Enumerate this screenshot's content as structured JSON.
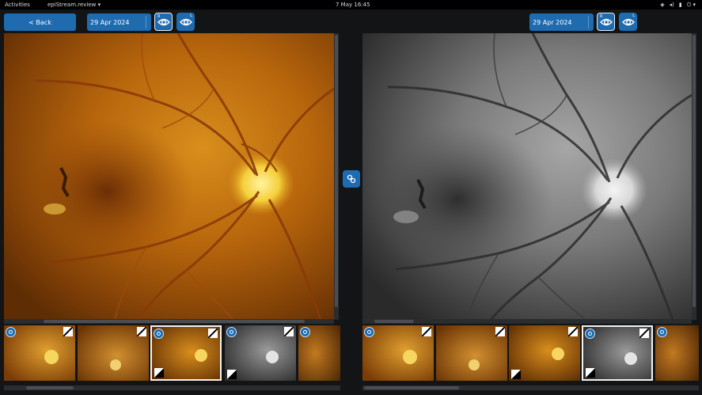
{
  "system_bar": {
    "activities": "Activities",
    "app_name": "epiStream.review ▾",
    "clock": "7 May  16:45",
    "tray_icons": [
      "network-icon",
      "volume-icon",
      "battery-icon",
      "power-icon"
    ],
    "tray_glyphs": [
      "◈",
      "◂)",
      "▮",
      "⏻ ▾"
    ]
  },
  "toolbar": {
    "back_label": "< Back"
  },
  "left_viewer": {
    "date": "29 Apr 2024",
    "eye_right_label": "R",
    "eye_left_label": "L",
    "image_kind": "color-fundus"
  },
  "right_viewer": {
    "date": "29 Apr 2024",
    "eye_right_label": "R",
    "eye_left_label": "L",
    "image_kind": "red-free-fundus"
  },
  "link_button": {
    "icon": "link-icon"
  },
  "left_strip": {
    "thumbnails": [
      {
        "kind": "color"
      },
      {
        "kind": "color"
      },
      {
        "kind": "color",
        "selected": true
      },
      {
        "kind": "gray"
      },
      {
        "kind": "color"
      }
    ]
  },
  "right_strip": {
    "thumbnails": [
      {
        "kind": "color"
      },
      {
        "kind": "color"
      },
      {
        "kind": "color"
      },
      {
        "kind": "gray",
        "selected": true
      },
      {
        "kind": "color"
      }
    ]
  },
  "colors": {
    "accent": "#1e6bb0",
    "background": "#121416",
    "topbar": "#000000"
  }
}
